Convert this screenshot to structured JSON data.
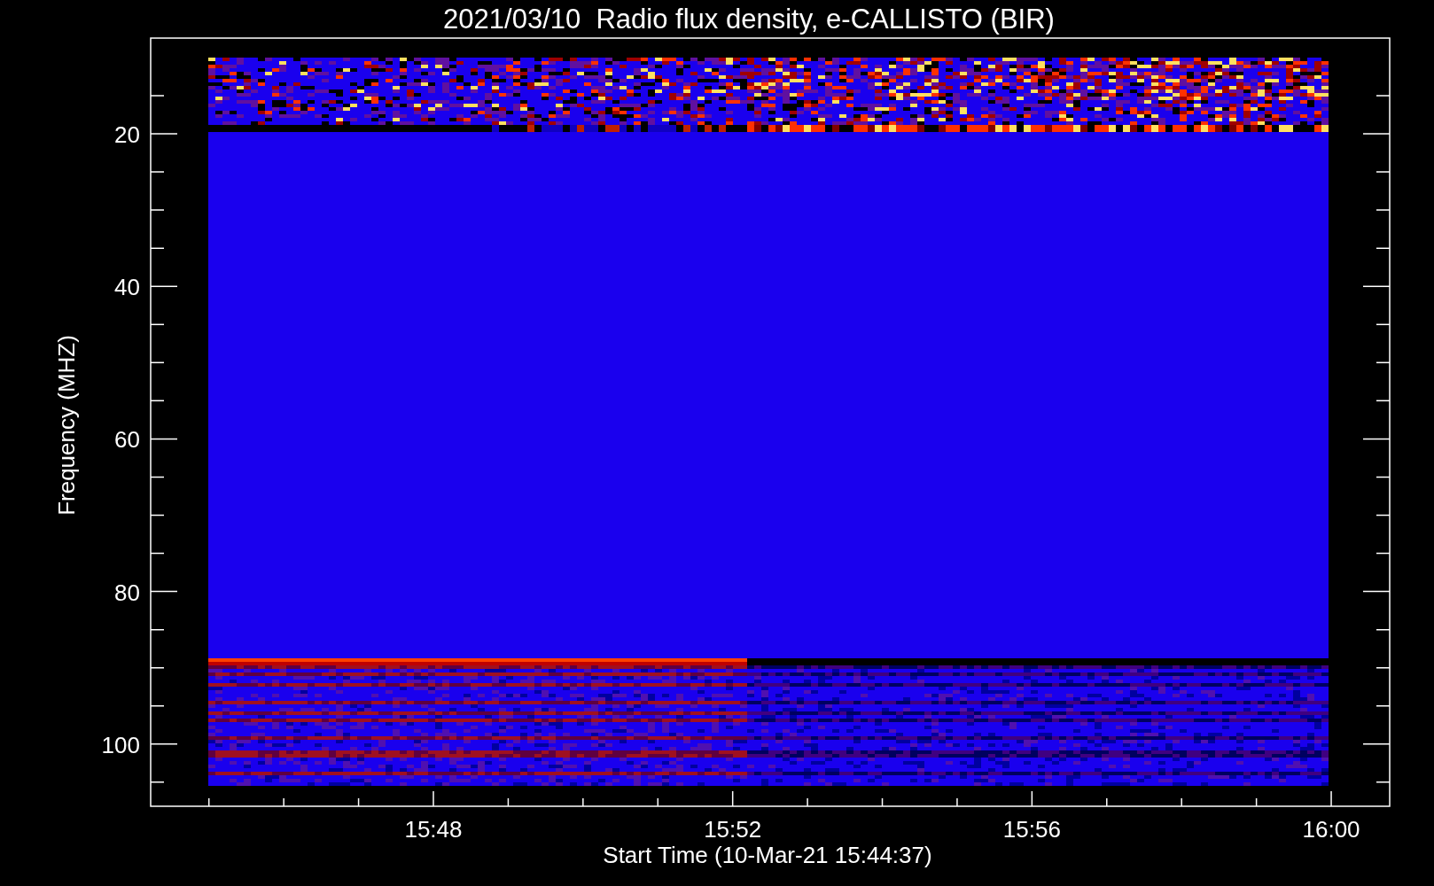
{
  "title": "2021/03/10  Radio flux density, e-CALLISTO (BIR)",
  "y_axis": {
    "label": "Frequency (MHZ)",
    "ticks": [
      "20",
      "40",
      "60",
      "80",
      "100"
    ]
  },
  "x_axis": {
    "label": "Start Time (10-Mar-21 15:44:37)",
    "ticks": [
      "15:48",
      "15:52",
      "15:56",
      "16:00"
    ]
  }
}
